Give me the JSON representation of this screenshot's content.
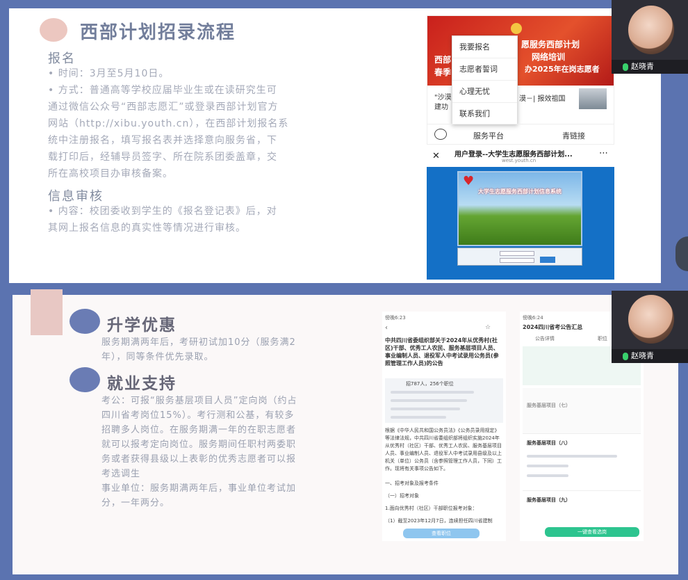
{
  "slide1": {
    "title": "西部计划招录流程",
    "sec1_heading": "报名",
    "sec1_time": "时间：3月至5月10日。",
    "sec1_method_lines": [
      "方式：普通高等学校应届毕业生或在读研究生可",
      "通过微信公众号“西部志愿汇”或登录西部计划官方",
      "网站（http://xibu.youth.cn），在西部计划报名系",
      "统中注册报名，填写报名表并选择意向服务省，下",
      "载打印后，经辅导员签字、所在院系团委盖章，交",
      "所在高校项目办审核备案。"
    ],
    "sec2_heading": "信息审核",
    "sec2_lines": [
      "内容：校团委收到学生的《报名登记表》后，对",
      "其网上报名信息的真实性等情况进行审核。"
    ],
    "wechat": {
      "banner_lines": [
        "愿服务西部计划",
        "网络培训",
        "办2025年在岗志愿者"
      ],
      "banner_left": [
        "西部",
        "春季"
      ],
      "menu": [
        "我要报名",
        "志愿者誓词",
        "心理无忧",
        "联系我们"
      ],
      "article_left": [
        "\"沙漠",
        "建功"
      ],
      "article_right": "漠－| 报效祖国",
      "nav": [
        "服务平台",
        "青链接"
      ]
    },
    "login": {
      "title": "用户登录--大学生志愿服务西部计划...",
      "url": "west.youth.cn",
      "banner_text": "大学生志愿服务西部计划信息系统"
    }
  },
  "slide2": {
    "heading1": "升学优惠",
    "para1": [
      "服务期满两年后，考研初试加10分（服务满2",
      "年），同等条件优先录取。"
    ],
    "heading2": "就业支持",
    "para2": [
      "考公：可报“服务基层项目人员”定向岗（约占",
      "四川省考岗位15%）。考行测和公基，有较多",
      "招聘多人岗位。在服务期满一年的在职志愿者",
      "就可以报考定向岗位。服务期间任职村两委职",
      "务或者获得县级以上表彰的优秀志愿者可以报",
      "考选调生",
      "事业单位：服务期满两年后，事业单位考试加",
      "分，一年两分。"
    ],
    "phone1": {
      "time": "傍晚6:23",
      "title": "中共四川省委组织部关于2024年从优秀村(社区)干部、优秀工人农民、服务基层项目人员、事业编制人员、退役军人中考试录用公务员(参照管理工作人员)的公告",
      "summary": "招787人，256个职位",
      "body": "根据《中华人民共和国公务员法》《公务员录用规定》等法律法规，中共四川省委组织部将组织实施2024年从优秀村（社区）干部、优秀工人农民、服务基层项目人员、事业编制人员、退役军人中考试录用县级及以上机关（单位）公务员（含参照管理工作人员，下同）工作。现将有关事项公告如下。",
      "s1": "一、招考对象及报考条件",
      "s2": "（一）招考对象",
      "s3": "1.面向优秀村（社区）干部职位报考对象：",
      "s4": "（1）截至2023年12月7日，连续担任四川省建制",
      "btn": "查看职位"
    },
    "phone2": {
      "time": "傍晚6:24",
      "title": "2024四川省考公告汇总",
      "tabs": [
        "公告详情",
        "职位"
      ],
      "items": [
        "服务基层项目（七）",
        "服务基层项目（八）",
        "服务基层项目（九）"
      ],
      "btn": "一键查看选岗"
    }
  },
  "participants": [
    {
      "name": "赵晓青"
    },
    {
      "name": "赵晓青"
    }
  ],
  "colors": {
    "background": "#5b73b0",
    "dot_blue": "#6a7cb4",
    "dot_pink": "#e8c1bb",
    "accent_red": "#c9201c"
  }
}
